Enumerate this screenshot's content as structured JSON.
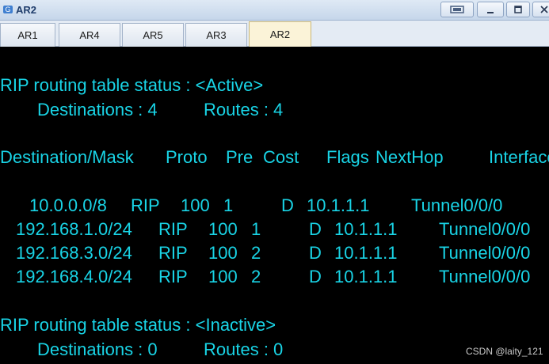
{
  "window": {
    "title": "AR2",
    "buttons": {
      "minimize": "_",
      "maximize": "□",
      "close": "×"
    }
  },
  "tabs": [
    {
      "label": "AR1"
    },
    {
      "label": "AR4"
    },
    {
      "label": "AR5"
    },
    {
      "label": "AR3"
    },
    {
      "label": "AR2",
      "active": true
    }
  ],
  "terminal": {
    "lines": [
      "RIP routing table status : <Active>",
      "Destinations : 4",
      "Routes : 4",
      "Destination/Mask",
      "Proto",
      "Pre",
      "Cost",
      "Flags",
      "NextHop",
      "Interface",
      "10.0.0.0/8",
      "RIP",
      "100",
      "1",
      "D",
      "10.1.1.1",
      "Tunnel0/0/0",
      "192.168.1.0/24",
      "RIP",
      "100",
      "1",
      "D",
      "10.1.1.1",
      "Tunnel0/0/0",
      "192.168.3.0/24",
      "RIP",
      "100",
      "2",
      "D",
      "10.1.1.1",
      "Tunnel0/0/0",
      "192.168.4.0/24",
      "RIP",
      "100",
      "2",
      "D",
      "10.1.1.1",
      "Tunnel0/0/0",
      "RIP routing table status : <Inactive>",
      "Destinations : 0",
      "Routes : 0"
    ]
  },
  "watermark": "CSDN @laity_121",
  "colors": {
    "terminal_text": "#19d4e6",
    "terminal_bg": "#000000"
  }
}
